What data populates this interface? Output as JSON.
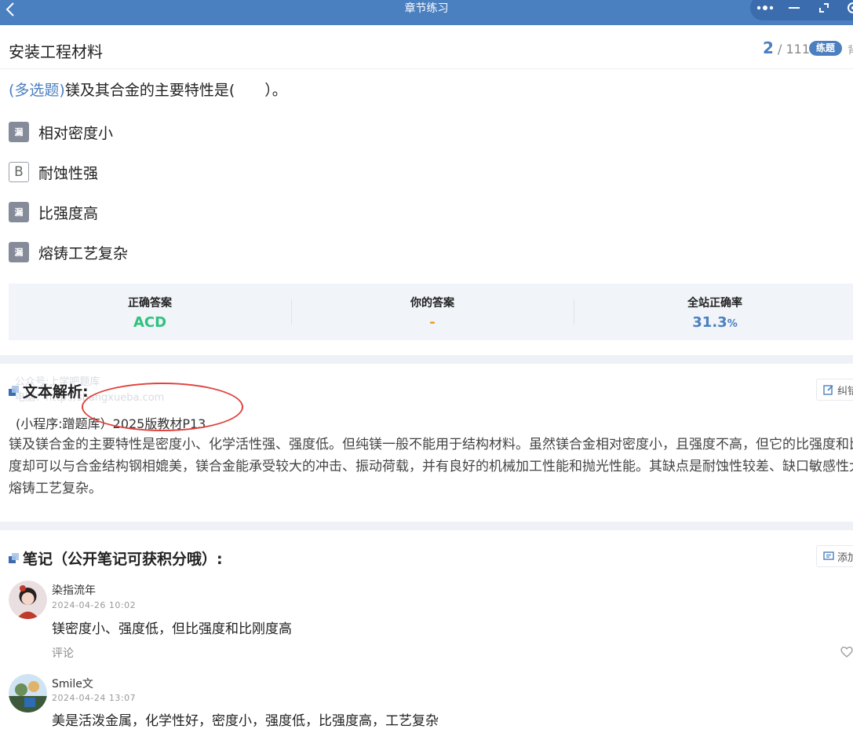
{
  "nav": {
    "title": "章节练习"
  },
  "header": {
    "subject": "安装工程材料",
    "current": "2",
    "total": "/ 111",
    "mode": "练题",
    "mode_extra": "背"
  },
  "question": {
    "type_label": "(多选题)",
    "text": "镁及其合金的主要特性是(　　）。",
    "options": [
      {
        "badge": "漏",
        "badge_kind": "miss",
        "text": "相对密度小"
      },
      {
        "badge": "B",
        "badge_kind": "letter",
        "text": "耐蚀性强"
      },
      {
        "badge": "漏",
        "badge_kind": "miss",
        "text": "比强度高"
      },
      {
        "badge": "漏",
        "badge_kind": "miss",
        "text": "熔铸工艺复杂"
      }
    ]
  },
  "answers": {
    "correct_label": "正确答案",
    "correct_value": "ACD",
    "yours_label": "你的答案",
    "yours_value": "-",
    "rate_label": "全站正确率",
    "rate_value": "31.3",
    "rate_unit": "%"
  },
  "analysis": {
    "title": "文本解析:",
    "correct_btn": "纠错",
    "watermark_line1": "公众号:上学吧题库",
    "watermark_line2": "电脑：http://shangxueba.com",
    "source": "(小程序:蹭题库）2025版教材P13",
    "body": "镁及镁合金的主要特性是密度小、化学活性强、强度低。但纯镁一般不能用于结构材料。虽然镁合金相对密度小，且强度不高，但它的比强度和比刚度却可以与合金结构钢相媲美，镁合金能承受较大的冲击、振动荷载，并有良好的机械加工性能和抛光性能。其缺点是耐蚀性较差、缺口敏感性大及熔铸工艺复杂。"
  },
  "notes": {
    "title": "笔记（公开笔记可获积分哦）:",
    "add_btn": "添加",
    "items": [
      {
        "author": "染指流年",
        "time": "2024-04-26 10:02",
        "content": "镁密度小、强度低，但比强度和比刚度高",
        "comment": "评论"
      },
      {
        "author": "Smile文",
        "time": "2024-04-24 13:07",
        "content": "美是活泼金属，化学性好，密度小，强度低，比强度高，工艺复杂"
      }
    ]
  },
  "colors": {
    "nav": "#4a7fc0",
    "accent": "#4a7fc0",
    "correct": "#2ec27e",
    "yours": "#f39c12",
    "annotation": "#e0423d"
  }
}
